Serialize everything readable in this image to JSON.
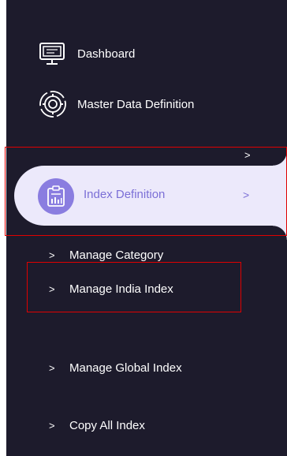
{
  "sidebar": {
    "items": [
      {
        "label": "Dashboard",
        "icon": "monitor-icon"
      },
      {
        "label": "Master Data Definition",
        "icon": "gear-icon"
      }
    ],
    "active": {
      "label": "Index Definition",
      "icon": "clipboard-chart-icon",
      "chevron": ">"
    },
    "stray_chevron": ">",
    "sub_items": [
      {
        "label": "Manage Category",
        "chevron": ">"
      },
      {
        "label": "Manage India Index",
        "chevron": ">"
      },
      {
        "label": "Manage Global Index",
        "chevron": ">"
      },
      {
        "label": "Copy All Index",
        "chevron": ">"
      }
    ]
  },
  "colors": {
    "background": "#1d1b2c",
    "active_bg": "#ece9fb",
    "accent": "#7b6fd6",
    "highlight": "#e00000"
  }
}
